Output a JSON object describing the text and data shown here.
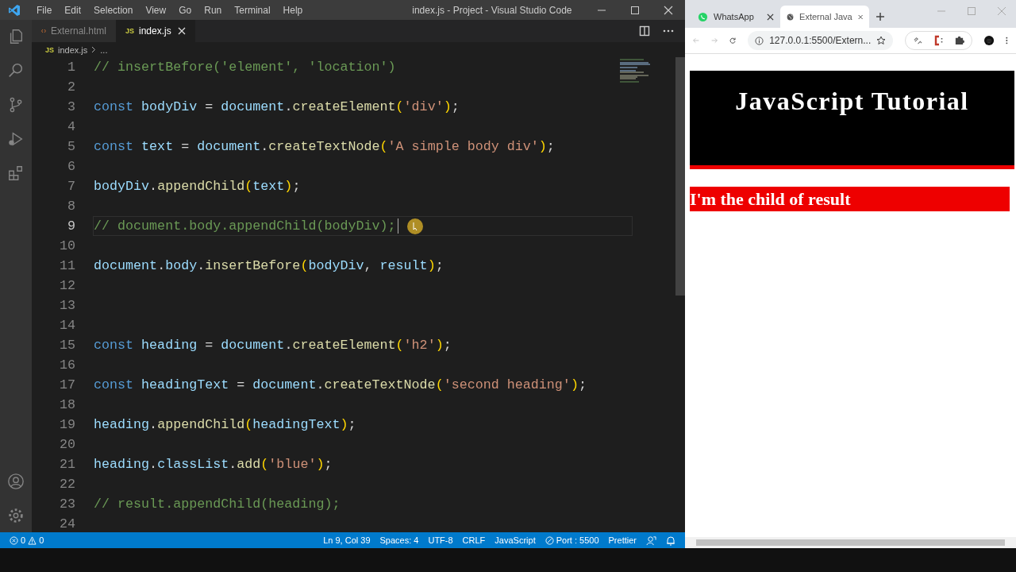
{
  "vscode": {
    "menu": [
      "File",
      "Edit",
      "Selection",
      "View",
      "Go",
      "Run",
      "Terminal",
      "Help"
    ],
    "title": "index.js - Project - Visual Studio Code",
    "tabs": [
      {
        "label": "External.html",
        "kind": "html",
        "selected": false
      },
      {
        "label": "index.js",
        "kind": "js",
        "badge": "JS",
        "selected": true
      }
    ],
    "breadcrumb": {
      "badge": "JS",
      "file": "index.js",
      "more": "..."
    },
    "code": [
      {
        "number": "1",
        "current": false,
        "tokens": [
          {
            "kind": "c",
            "text": "// insertBefore('element', 'location')"
          }
        ]
      },
      {
        "number": "2",
        "current": false
      },
      {
        "number": "3",
        "current": false,
        "tokens": [
          {
            "kind": "k",
            "text": "const "
          },
          {
            "kind": "v",
            "text": "bodyDiv"
          },
          {
            "kind": "p",
            "text": " = "
          },
          {
            "kind": "v",
            "text": "document"
          },
          {
            "kind": "p",
            "text": "."
          },
          {
            "kind": "f",
            "text": "createElement"
          },
          {
            "kind": "b",
            "text": "("
          },
          {
            "kind": "s",
            "text": "'div'"
          },
          {
            "kind": "b",
            "text": ")"
          },
          {
            "kind": "p",
            "text": ";"
          }
        ]
      },
      {
        "number": "4",
        "current": false
      },
      {
        "number": "5",
        "current": false,
        "tokens": [
          {
            "kind": "k",
            "text": "const "
          },
          {
            "kind": "v",
            "text": "text"
          },
          {
            "kind": "p",
            "text": " = "
          },
          {
            "kind": "v",
            "text": "document"
          },
          {
            "kind": "p",
            "text": "."
          },
          {
            "kind": "f",
            "text": "createTextNode"
          },
          {
            "kind": "b",
            "text": "("
          },
          {
            "kind": "s",
            "text": "'A simple body div'"
          },
          {
            "kind": "b",
            "text": ")"
          },
          {
            "kind": "p",
            "text": ";"
          }
        ]
      },
      {
        "number": "6",
        "current": false
      },
      {
        "number": "7",
        "current": false,
        "tokens": [
          {
            "kind": "v",
            "text": "bodyDiv"
          },
          {
            "kind": "p",
            "text": "."
          },
          {
            "kind": "f",
            "text": "appendChild"
          },
          {
            "kind": "b",
            "text": "("
          },
          {
            "kind": "v",
            "text": "text"
          },
          {
            "kind": "b",
            "text": ")"
          },
          {
            "kind": "p",
            "text": ";"
          }
        ]
      },
      {
        "number": "8",
        "current": false
      },
      {
        "number": "9",
        "current": true,
        "tokens": [
          {
            "kind": "c",
            "text": "// document.body.appendChild(bodyDiv);"
          }
        ]
      },
      {
        "number": "10",
        "current": false
      },
      {
        "number": "11",
        "current": false,
        "tokens": [
          {
            "kind": "v",
            "text": "document"
          },
          {
            "kind": "p",
            "text": "."
          },
          {
            "kind": "v",
            "text": "body"
          },
          {
            "kind": "p",
            "text": "."
          },
          {
            "kind": "f",
            "text": "insertBefore"
          },
          {
            "kind": "b",
            "text": "("
          },
          {
            "kind": "v",
            "text": "bodyDiv"
          },
          {
            "kind": "p",
            "text": ", "
          },
          {
            "kind": "v",
            "text": "result"
          },
          {
            "kind": "b",
            "text": ")"
          },
          {
            "kind": "p",
            "text": ";"
          }
        ]
      },
      {
        "number": "12",
        "current": false
      },
      {
        "number": "13",
        "current": false
      },
      {
        "number": "14",
        "current": false
      },
      {
        "number": "15",
        "current": false,
        "tokens": [
          {
            "kind": "k",
            "text": "const "
          },
          {
            "kind": "v",
            "text": "heading"
          },
          {
            "kind": "p",
            "text": " = "
          },
          {
            "kind": "v",
            "text": "document"
          },
          {
            "kind": "p",
            "text": "."
          },
          {
            "kind": "f",
            "text": "createElement"
          },
          {
            "kind": "b",
            "text": "("
          },
          {
            "kind": "s",
            "text": "'h2'"
          },
          {
            "kind": "b",
            "text": ")"
          },
          {
            "kind": "p",
            "text": ";"
          }
        ]
      },
      {
        "number": "16",
        "current": false
      },
      {
        "number": "17",
        "current": false,
        "tokens": [
          {
            "kind": "k",
            "text": "const "
          },
          {
            "kind": "v",
            "text": "headingText"
          },
          {
            "kind": "p",
            "text": " = "
          },
          {
            "kind": "v",
            "text": "document"
          },
          {
            "kind": "p",
            "text": "."
          },
          {
            "kind": "f",
            "text": "createTextNode"
          },
          {
            "kind": "b",
            "text": "("
          },
          {
            "kind": "s",
            "text": "'second heading'"
          },
          {
            "kind": "b",
            "text": ")"
          },
          {
            "kind": "p",
            "text": ";"
          }
        ]
      },
      {
        "number": "18",
        "current": false
      },
      {
        "number": "19",
        "current": false,
        "tokens": [
          {
            "kind": "v",
            "text": "heading"
          },
          {
            "kind": "p",
            "text": "."
          },
          {
            "kind": "f",
            "text": "appendChild"
          },
          {
            "kind": "b",
            "text": "("
          },
          {
            "kind": "v",
            "text": "headingText"
          },
          {
            "kind": "b",
            "text": ")"
          },
          {
            "kind": "p",
            "text": ";"
          }
        ]
      },
      {
        "number": "20",
        "current": false
      },
      {
        "number": "21",
        "current": false,
        "tokens": [
          {
            "kind": "v",
            "text": "heading"
          },
          {
            "kind": "p",
            "text": "."
          },
          {
            "kind": "v",
            "text": "classList"
          },
          {
            "kind": "p",
            "text": "."
          },
          {
            "kind": "f",
            "text": "add"
          },
          {
            "kind": "b",
            "text": "("
          },
          {
            "kind": "s",
            "text": "'blue'"
          },
          {
            "kind": "b",
            "text": ")"
          },
          {
            "kind": "p",
            "text": ";"
          }
        ]
      },
      {
        "number": "22",
        "current": false
      },
      {
        "number": "23",
        "current": false,
        "tokens": [
          {
            "kind": "c",
            "text": "// result.appendChild(heading);"
          }
        ]
      },
      {
        "number": "24",
        "current": false
      }
    ],
    "status_bar": {
      "errors": "0",
      "warnings": "0",
      "items": [
        {
          "kind": "plain",
          "text": "Ln 9, Col 39"
        },
        {
          "kind": "plain",
          "text": "Spaces: 4"
        },
        {
          "kind": "plain",
          "text": "UTF-8"
        },
        {
          "kind": "plain",
          "text": "CRLF"
        },
        {
          "kind": "plain",
          "text": "JavaScript"
        },
        {
          "kind": "port",
          "text": "Port : 5500"
        },
        {
          "kind": "plain",
          "text": "Prettier"
        }
      ]
    }
  },
  "browser": {
    "tabs": [
      {
        "label": "WhatsApp",
        "kind": "whatsapp",
        "selected": false
      },
      {
        "label": "External Java",
        "kind": "globe",
        "selected": true
      }
    ],
    "url": "127.0.0.1:5500/Extern...",
    "page": {
      "heading": "JavaScript Tutorial",
      "result_text": "I'm the child of result"
    }
  }
}
